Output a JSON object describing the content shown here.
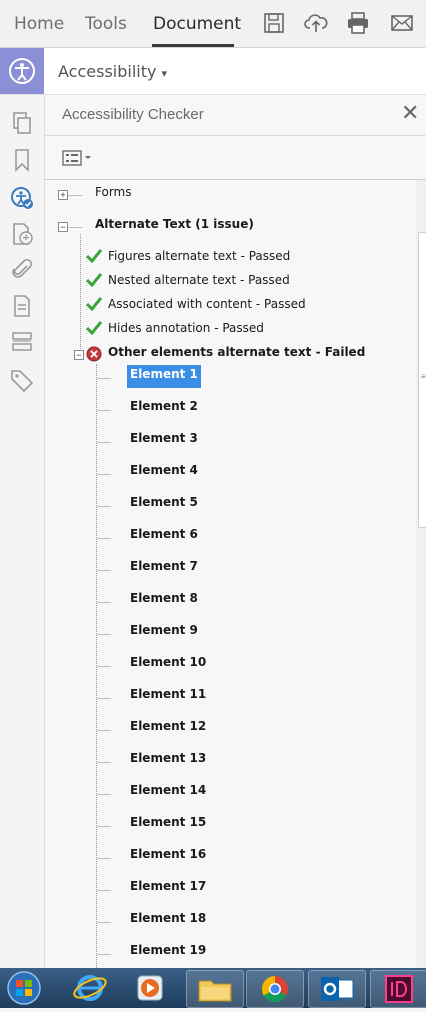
{
  "tabs": [
    {
      "label": "Home",
      "active": false
    },
    {
      "label": "Tools",
      "active": false
    },
    {
      "label": "Document",
      "active": true
    }
  ],
  "toolbar_icons": [
    "save-icon",
    "cloud-upload-icon",
    "print-icon",
    "mail-icon"
  ],
  "panel": {
    "title": "Accessibility",
    "dropdown": "▾"
  },
  "rail_icons": [
    "pages-icon",
    "bookmark-icon",
    "accessibility-check-icon",
    "reading-order-icon",
    "attachment-icon",
    "page-properties-icon",
    "content-icon",
    "tags-icon"
  ],
  "checker": {
    "title": "Accessibility Checker",
    "close_label": "✕",
    "options_icon": "options-menu-icon"
  },
  "tree": {
    "forms": "Forms",
    "alt_text": "Alternate Text (1 issue)",
    "checks": [
      {
        "label": "Figures alternate text - Passed",
        "status": "passed"
      },
      {
        "label": "Nested alternate text - Passed",
        "status": "passed"
      },
      {
        "label": "Associated with content - Passed",
        "status": "passed"
      },
      {
        "label": "Hides annotation - Passed",
        "status": "passed"
      }
    ],
    "failed": {
      "label": "Other elements alternate text - Failed",
      "status": "failed"
    },
    "elements": [
      "Element 1",
      "Element 2",
      "Element 3",
      "Element 4",
      "Element 5",
      "Element 6",
      "Element 7",
      "Element 8",
      "Element 9",
      "Element 10",
      "Element 11",
      "Element 12",
      "Element 13",
      "Element 14",
      "Element 15",
      "Element 16",
      "Element 17",
      "Element 18",
      "Element 19"
    ],
    "selected_index": 0
  },
  "taskbar": [
    "start-button",
    "internet-explorer-icon",
    "media-player-icon",
    "file-explorer-icon",
    "chrome-icon",
    "outlook-icon",
    "indesign-icon"
  ],
  "colors": {
    "selection": "#3a8ee6",
    "accent": "#8a8fd6",
    "taskbar": "#2b4c70",
    "passed": "#3aa63a",
    "failed": "#c43b3b"
  }
}
